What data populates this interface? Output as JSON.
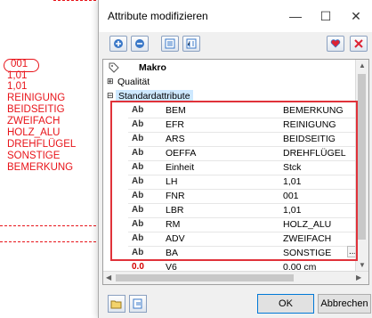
{
  "cad": {
    "lines": [
      "001",
      "1,01",
      "1,01",
      "REINIGUNG",
      "BEIDSEITIG",
      "ZWEIFACH",
      "HOLZ_ALU",
      "DREHFLÜGEL",
      "SONSTIGE",
      "BEMERKUNG"
    ]
  },
  "dialog": {
    "title": "Attribute modifizieren",
    "minimize": "—",
    "maximize": "☐",
    "close": "✕"
  },
  "tree": {
    "root": "Makro",
    "nodes": [
      {
        "label": "Qualität",
        "expander": "⊞"
      },
      {
        "label": "Standardattribute",
        "expander": "⊟"
      }
    ]
  },
  "rows": [
    {
      "type": "Ab",
      "name": "BEM",
      "value": "BEMERKUNG"
    },
    {
      "type": "Ab",
      "name": "EFR",
      "value": "REINIGUNG"
    },
    {
      "type": "Ab",
      "name": "ARS",
      "value": "BEIDSEITIG"
    },
    {
      "type": "Ab",
      "name": "OEFFA",
      "value": "DREHFLÜGEL"
    },
    {
      "type": "Ab",
      "name": "Einheit",
      "value": "Stck"
    },
    {
      "type": "Ab",
      "name": "LH",
      "value": "1,01"
    },
    {
      "type": "Ab",
      "name": "FNR",
      "value": "001"
    },
    {
      "type": "Ab",
      "name": "LBR",
      "value": "1,01"
    },
    {
      "type": "Ab",
      "name": "RM",
      "value": "HOLZ_ALU"
    },
    {
      "type": "Ab",
      "name": "ADV",
      "value": "ZWEIFACH"
    },
    {
      "type": "Ab",
      "name": "BA",
      "value": "SONSTIGE",
      "extra": "..."
    },
    {
      "type": "0.0",
      "name": "V6",
      "value": "0.00 cm"
    }
  ],
  "buttons": {
    "ok": "OK",
    "cancel": "Abbrechen"
  },
  "colors": {
    "cad_red": "#e8141a",
    "highlight": "#e0323a",
    "selection": "#cde8ff"
  }
}
